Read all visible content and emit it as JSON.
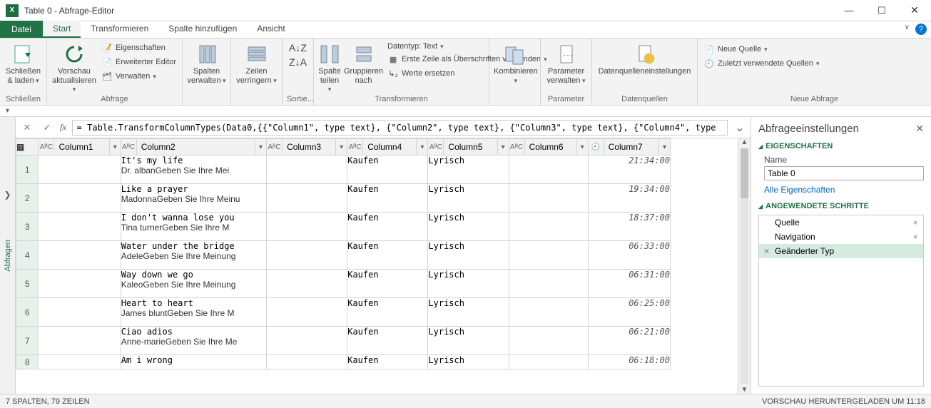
{
  "window": {
    "title": "Table 0 - Abfrage-Editor",
    "app_icon_text": "X"
  },
  "tabs": {
    "file": "Datei",
    "items": [
      "Start",
      "Transformieren",
      "Spalte hinzufügen",
      "Ansicht"
    ],
    "active_index": 0
  },
  "ribbon": {
    "close_load": "Schließen\n& laden",
    "close_group": "Schließen",
    "refresh": "Vorschau\naktualisieren",
    "properties": "Eigenschaften",
    "advanced_editor": "Erweiterter Editor",
    "manage": "Verwalten",
    "query_group": "Abfrage",
    "manage_cols": "Spalten\nverwalten",
    "reduce_rows": "Zeilen\nverringern",
    "sort_group": "Sortie...",
    "split_col": "Spalte\nteilen",
    "group_by": "Gruppieren\nnach",
    "datatype": "Datentyp: Text",
    "first_row": "Erste Zeile als Überschriften verwenden",
    "replace": "Werte ersetzen",
    "transform_group": "Transformieren",
    "combine": "Kombinieren",
    "parameters": "Parameter\nverwalten",
    "parameters_group": "Parameter",
    "datasources": "Datenquelleneinstellungen",
    "datasources_group": "Datenquellen",
    "new_source": "Neue Quelle",
    "recent_sources": "Zuletzt verwendete Quellen",
    "new_query_group": "Neue Abfrage"
  },
  "queries_rail": "Abfragen",
  "formula": {
    "cancel_glyph": "✕",
    "accept_glyph": "✓",
    "fx_label": "fx",
    "text": "= Table.TransformColumnTypes(Data0,{{\"Column1\", type text}, {\"Column2\", type text}, {\"Column3\", type text}, {\"Column4\", type"
  },
  "chart_data": {
    "type": "table",
    "columns": [
      {
        "name": "Column1",
        "type": "ABC",
        "icon": "text"
      },
      {
        "name": "Column2",
        "type": "ABC",
        "icon": "text"
      },
      {
        "name": "Column3",
        "type": "ABC",
        "icon": "text"
      },
      {
        "name": "Column4",
        "type": "ABC",
        "icon": "text"
      },
      {
        "name": "Column5",
        "type": "ABC",
        "icon": "text"
      },
      {
        "name": "Column6",
        "type": "ABC",
        "icon": "text"
      },
      {
        "name": "Column7",
        "type": "",
        "icon": "time"
      }
    ],
    "rows": [
      {
        "n": 1,
        "c1": "",
        "c2a": "It's my life",
        "c2b": "Dr. albanGeben Sie Ihre Mei",
        "c3": "",
        "c4": "Kaufen",
        "c5": "Lyrisch",
        "c6": "",
        "c7": "21:34:00"
      },
      {
        "n": 2,
        "c1": "",
        "c2a": "Like a prayer",
        "c2b": "MadonnaGeben Sie Ihre Meinu",
        "c3": "",
        "c4": "Kaufen",
        "c5": "Lyrisch",
        "c6": "",
        "c7": "19:34:00"
      },
      {
        "n": 3,
        "c1": "",
        "c2a": "I don't wanna lose you",
        "c2b": "Tina turnerGeben Sie Ihre M",
        "c3": "",
        "c4": "Kaufen",
        "c5": "Lyrisch",
        "c6": "",
        "c7": "18:37:00"
      },
      {
        "n": 4,
        "c1": "",
        "c2a": "Water under the bridge",
        "c2b": "AdeleGeben Sie Ihre Meinung",
        "c3": "",
        "c4": "Kaufen",
        "c5": "Lyrisch",
        "c6": "",
        "c7": "06:33:00"
      },
      {
        "n": 5,
        "c1": "",
        "c2a": "Way down we go",
        "c2b": "KaleoGeben Sie Ihre Meinung",
        "c3": "",
        "c4": "Kaufen",
        "c5": "Lyrisch",
        "c6": "",
        "c7": "06:31:00"
      },
      {
        "n": 6,
        "c1": "",
        "c2a": "Heart to heart",
        "c2b": "James bluntGeben Sie Ihre M",
        "c3": "",
        "c4": "Kaufen",
        "c5": "Lyrisch",
        "c6": "",
        "c7": "06:25:00"
      },
      {
        "n": 7,
        "c1": "",
        "c2a": "Ciao adios",
        "c2b": "Anne-marieGeben Sie Ihre Me",
        "c3": "",
        "c4": "Kaufen",
        "c5": "Lyrisch",
        "c6": "",
        "c7": "06:21:00"
      },
      {
        "n": 8,
        "c1": "",
        "c2a": "Am i wrong",
        "c2b": "",
        "c3": "",
        "c4": "Kaufen",
        "c5": "Lyrisch",
        "c6": "",
        "c7": "06:18:00"
      }
    ]
  },
  "settings": {
    "title": "Abfrageeinstellungen",
    "props_header": "EIGENSCHAFTEN",
    "name_label": "Name",
    "name_value": "Table 0",
    "all_props": "Alle Eigenschaften",
    "steps_header": "ANGEWENDETE SCHRITTE",
    "steps": [
      {
        "name": "Quelle",
        "selected": false,
        "gear": true,
        "x": false
      },
      {
        "name": "Navigation",
        "selected": false,
        "gear": true,
        "x": false
      },
      {
        "name": "Geänderter Typ",
        "selected": true,
        "gear": false,
        "x": true
      }
    ]
  },
  "status": {
    "left": "7 SPALTEN, 79 ZEILEN",
    "right": "VORSCHAU HERUNTERGELADEN UM 11:18"
  }
}
